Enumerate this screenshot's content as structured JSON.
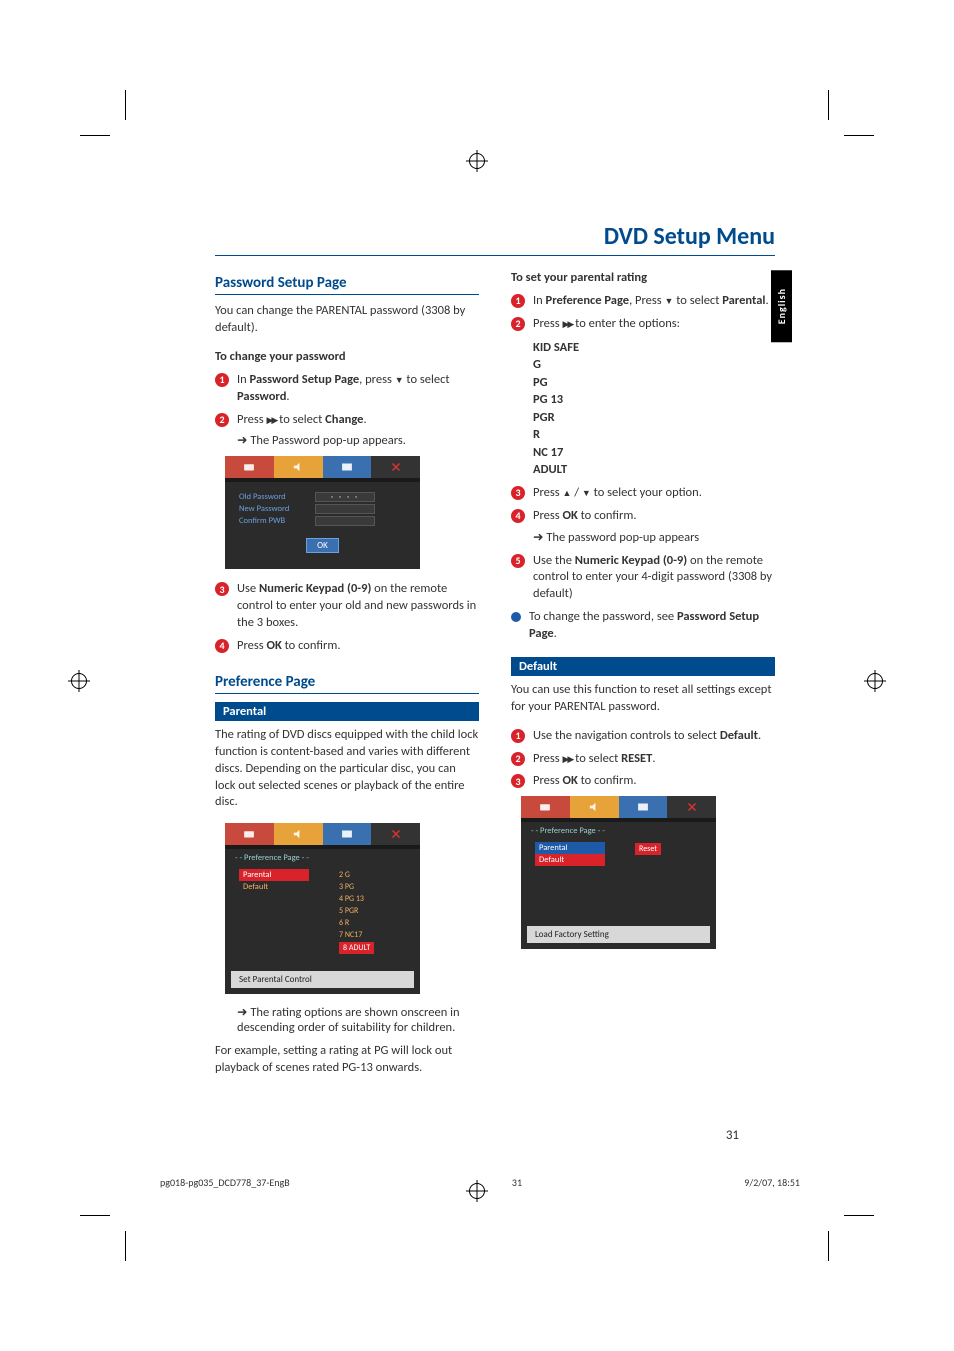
{
  "page_title": "DVD Setup Menu",
  "lang_tab": "English",
  "page_number": "31",
  "footer": {
    "file": "pg018-pg035_DCD778_37-EngB",
    "page": "31",
    "timestamp": "9/2/07, 18:51"
  },
  "left": {
    "h_password": "Password Setup Page",
    "pw_intro": "You can change the PARENTAL password (3308 by default).",
    "sub_change": "To change your password",
    "s1_a": "In ",
    "s1_b": "Password Setup Page",
    "s1_c": ", press ",
    "s1_d": " to select ",
    "s1_e": "Password",
    "s1_f": ".",
    "s2_a": "Press  ",
    "s2_b": " to select ",
    "s2_c": "Change",
    "s2_d": ".",
    "s2_res": "The Password pop-up appears.",
    "osd1": {
      "old": "Old Password",
      "new": "New Password",
      "confirm": "Confirm PWB",
      "ok": "OK"
    },
    "s3_a": "Use ",
    "s3_b": "Numeric Keypad (0-9)",
    "s3_c": " on the remote control to enter your old and new passwords in the 3 boxes.",
    "s4_a": "Press ",
    "s4_b": "OK",
    "s4_c": " to confirm.",
    "h_pref": "Preference Page",
    "bar_parental": "Parental",
    "parental_intro": "The rating of DVD discs equipped with the child lock function is content-based and varies with different discs. Depending on the particular disc, you can lock out selected scenes or playback of the entire disc.",
    "osd2": {
      "title": "- -   Preference Page   - -",
      "left_items": [
        "Parental",
        "Default"
      ],
      "right_items": [
        "2  G",
        "3  PG",
        "4  PG 13",
        "5  PGR",
        "6  R",
        "7  NC17",
        "8  ADULT"
      ],
      "caption": "Set Parental Control"
    },
    "rating_note": "The rating options are shown onscreen in descending order of suitability for children.",
    "example": "For example, setting a rating at PG will lock out playback of scenes rated PG-13 onwards."
  },
  "right": {
    "sub_set": "To set your parental rating",
    "r1_a": "In ",
    "r1_b": "Preference Page",
    "r1_c": ", Press ",
    "r1_d": " to select ",
    "r1_e": "Parental",
    "r1_f": ".",
    "r2_a": "Press  ",
    "r2_b": "  to enter the options:",
    "ratings": [
      "KID SAFE",
      "G",
      "PG",
      "PG 13",
      "PGR",
      "R",
      "NC 17",
      "ADULT"
    ],
    "r3_a": "Press  ",
    "r3_b": " / ",
    "r3_c": " to select your option.",
    "r4_a": "Press ",
    "r4_b": "OK",
    "r4_c": " to confirm.",
    "r4_res": "The password pop-up appears",
    "r5_a": "Use the  ",
    "r5_b": "Numeric Keypad (0-9)",
    "r5_c": " on the remote control to enter your 4-digit password (3308 by default)",
    "r6_a": "To change the password, see ",
    "r6_b": "Password Setup Page",
    "r6_c": ".",
    "bar_default": "Default",
    "def_intro": "You can use this function to reset all settings except for your PARENTAL password.",
    "d1_a": "Use the navigation controls to select ",
    "d1_b": "Default",
    "d1_c": ".",
    "d2_a": "Press ",
    "d2_b": "  to select ",
    "d2_c": "RESET",
    "d2_d": ".",
    "d3_a": "Press ",
    "d3_b": "OK",
    "d3_c": " to confirm.",
    "osd3": {
      "title": "- -   Preference Page   - -",
      "left_items": [
        "Parental",
        "Default"
      ],
      "right_sel": "Reset",
      "caption": "Load Factory Setting"
    }
  }
}
